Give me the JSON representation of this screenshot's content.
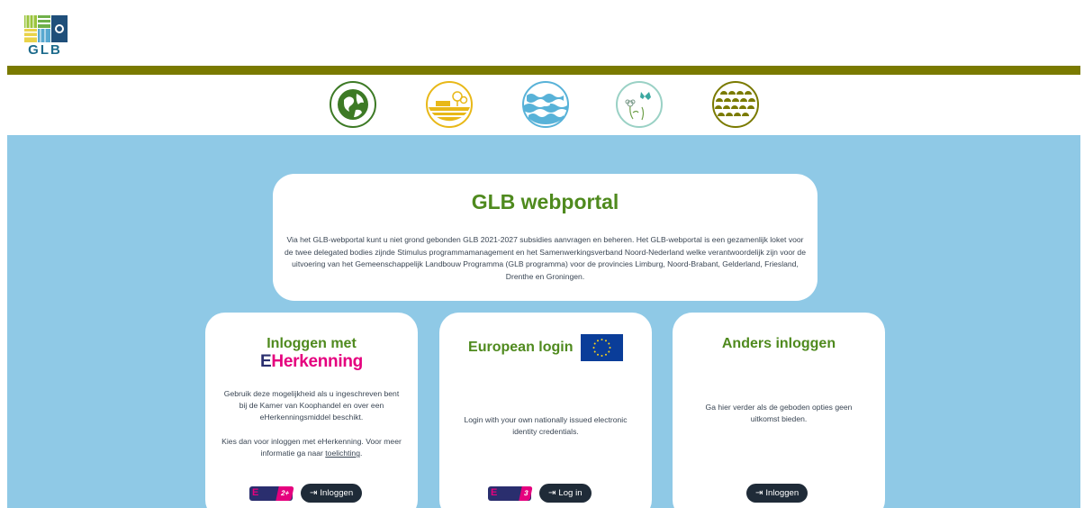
{
  "header": {
    "logo_text": "GLB"
  },
  "theme_icons": [
    {
      "name": "earth-icon",
      "color": "#3d7a25"
    },
    {
      "name": "farm-landscape-icon",
      "color": "#e8b818"
    },
    {
      "name": "water-waves-icon",
      "color": "#58b2d8"
    },
    {
      "name": "flowers-butterfly-icon",
      "color": "#9ad1c5"
    },
    {
      "name": "field-rows-icon",
      "color": "#7a7a00"
    }
  ],
  "intro": {
    "title": "GLB webportal",
    "text": "Via het GLB-webportal kunt u niet grond gebonden GLB 2021-2027 subsidies aanvragen en beheren. Het GLB-webportal is een gezamenlijk loket voor de twee delegated bodies zijnde Stimulus programmamanagement en het Samenwerkingsverband Noord-Nederland welke verantwoordelijk zijn voor de uitvoering van het Gemeenschappelijk Landbouw Programma (GLB programma) voor de provincies Limburg, Noord-Brabant, Gelderland, Friesland, Drenthe en Groningen."
  },
  "cards": {
    "eherkenning": {
      "title": "Inloggen met",
      "logo_e": "E",
      "logo_rest": "Herkenning",
      "text1": "Gebruik deze mogelijkheid als u ingeschreven bent bij de Kamer van Koophandel en over een eHerkenningsmiddel beschikt.",
      "text2_prefix": "Kies dan voor inloggen met eHerkenning. Voor meer informatie ga naar ",
      "link": "toelichting",
      "text2_suffix": ".",
      "badge_e": "E",
      "badge_level": "2+",
      "button": "Inloggen",
      "button_arrow": "⇥"
    },
    "european": {
      "title": "European login",
      "text": "Login with your own nationally issued electronic identity credentials.",
      "badge_e": "E",
      "badge_level": "3",
      "button": "Log in",
      "button_arrow": "⇥"
    },
    "other": {
      "title": "Anders inloggen",
      "text": "Ga hier verder als de geboden opties geen uitkomst bieden.",
      "button": "Inloggen",
      "button_arrow": "⇥"
    }
  },
  "colors": {
    "accent_green": "#4f8a1e",
    "olive_bar": "#7a7a00",
    "background_blue": "#8fc9e6",
    "button_dark": "#1f2b38",
    "eherkenning_pink": "#e5007e",
    "eu_blue": "#0a3d99"
  }
}
